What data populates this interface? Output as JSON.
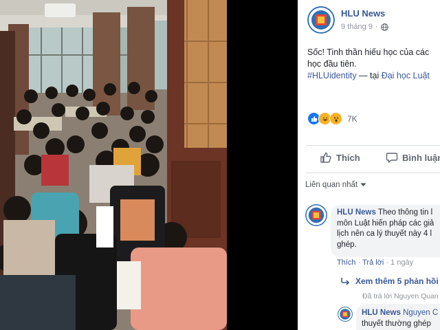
{
  "post": {
    "page_name": "HLU News",
    "date": "9 tháng 9",
    "separator": "·",
    "globe_icon": "globe-icon",
    "text_line1": "Sốc! Tinh thần hiếu học của các",
    "text_line2": "học đầu tiên.",
    "hashtag": "#HLUidentity",
    "at_text": " — tại ",
    "place": "Đại học Luật",
    "reaction_count": "7K",
    "reactions": [
      "like-reaction-icon",
      "haha-reaction-icon",
      "wow-reaction-icon"
    ]
  },
  "actions": {
    "like_label": "Thích",
    "comment_label": "Bình luận"
  },
  "comments": {
    "sort_label": "Liên quan nhất",
    "first": {
      "author": "HLU News",
      "line1": " Theo thông tin l",
      "line2": "môn Luật hiến pháp các giả",
      "line3": "lịch nên ca lý thuyết này 4 l",
      "line4": "ghép.",
      "like_label": "Thích",
      "reply_label": "Trả lời",
      "separator": " · ",
      "time": "1 ngày"
    },
    "more_replies_label": "Xem thêm 5 phản hồi",
    "replied_note": "Đã trả lời Nguyen Quan",
    "reply": {
      "author": "HLU News",
      "line1_rest": " Nguyen C",
      "line2": "thuyết thường ghép"
    }
  },
  "colors": {
    "link": "#385898",
    "like_blue": "#1877f2",
    "reaction_yellow": "#f7b125"
  }
}
